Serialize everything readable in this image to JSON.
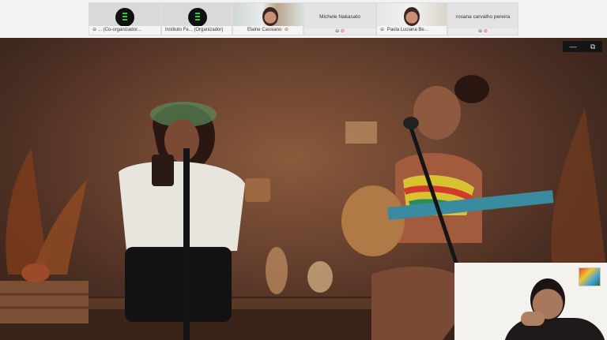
{
  "participants": [
    {
      "name": "(Co-organizador...",
      "prefix": "...",
      "kind": "logo"
    },
    {
      "name": "Instituto Fe... (Organizador)",
      "prefix": "",
      "kind": "logo"
    },
    {
      "name": "Elaine Cassiano",
      "prefix": "",
      "kind": "video"
    },
    {
      "name": "Michele Nakasato",
      "prefix": "",
      "kind": "name"
    },
    {
      "name": "Paula Luciana Be...",
      "prefix": "",
      "kind": "video"
    },
    {
      "name": "rosana carvalho pereira",
      "prefix": "",
      "kind": "name"
    }
  ],
  "icons": {
    "participant_status": "screen-share-icon",
    "mute": "muted-mic-icon",
    "minimize": "minimize-icon",
    "restore": "restore-window-icon"
  },
  "window_controls": {
    "minimize": "—",
    "restore": "⧉"
  },
  "colors": {
    "muted": "#dd3333",
    "topbar": "#f2f2f2",
    "stage_bg": "#1f1f1f"
  }
}
